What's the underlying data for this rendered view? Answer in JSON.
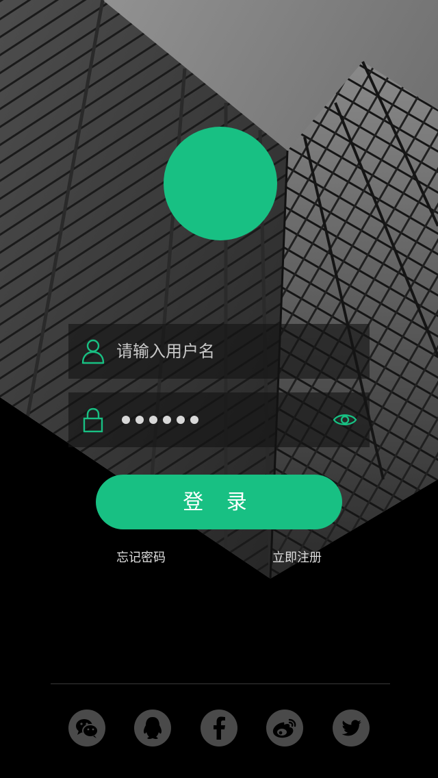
{
  "login": {
    "username_placeholder": "请输入用户名",
    "password_mask_count": 6,
    "login_button": "登 录",
    "forgot_password": "忘记密码",
    "register_now": "立即注册"
  },
  "colors": {
    "accent": "#18c083",
    "background": "#000000",
    "social_circle": "#4a4a4a",
    "field_background": "#141414"
  },
  "icons": {
    "username": "user-icon",
    "password": "lock-icon",
    "show_password": "eye-icon"
  },
  "social": [
    {
      "name": "wechat",
      "icon": "wechat-icon"
    },
    {
      "name": "qq",
      "icon": "qq-icon"
    },
    {
      "name": "facebook",
      "icon": "facebook-icon"
    },
    {
      "name": "weibo",
      "icon": "weibo-icon"
    },
    {
      "name": "twitter",
      "icon": "twitter-icon"
    }
  ]
}
